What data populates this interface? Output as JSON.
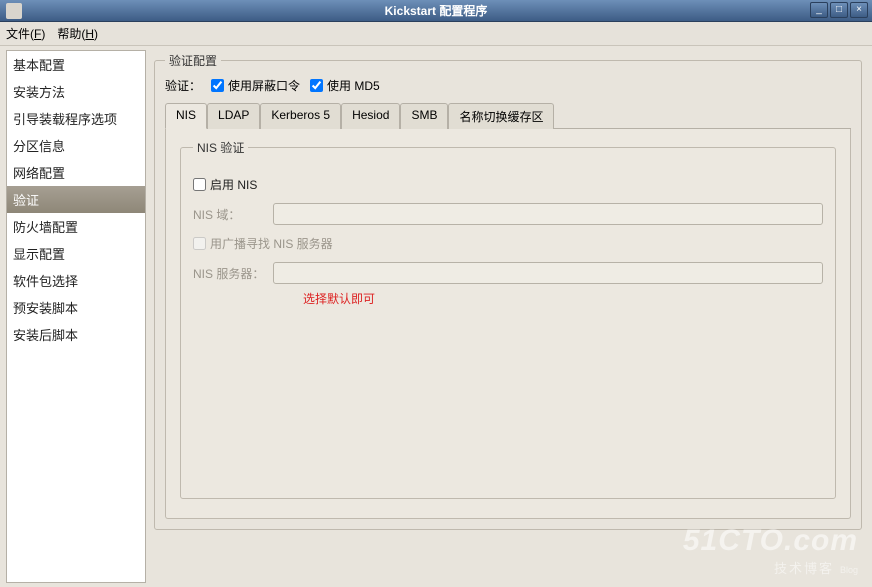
{
  "window": {
    "title": "Kickstart 配置程序",
    "min": "_",
    "max": "□",
    "close": "×"
  },
  "menu": {
    "file": "文件",
    "file_mn": "F",
    "help": "帮助",
    "help_mn": "H"
  },
  "sidebar": {
    "items": [
      "基本配置",
      "安装方法",
      "引导装载程序选项",
      "分区信息",
      "网络配置",
      "验证",
      "防火墙配置",
      "显示配置",
      "软件包选择",
      "预安装脚本",
      "安装后脚本"
    ],
    "selected_index": 5
  },
  "auth": {
    "group_title": "验证配置",
    "label": "验证：",
    "shadow_label": "使用屏蔽口令",
    "shadow_checked": true,
    "md5_label": "使用 MD5",
    "md5_checked": true
  },
  "tabs": {
    "items": [
      "NIS",
      "LDAP",
      "Kerberos 5",
      "Hesiod",
      "SMB",
      "名称切换缓存区"
    ],
    "active_index": 0
  },
  "nis": {
    "group_title": "NIS 验证",
    "enable_label": "启用 NIS",
    "enable_checked": false,
    "domain_label": "NIS 域：",
    "domain_value": "",
    "broadcast_label": "用广播寻找 NIS 服务器",
    "broadcast_checked": false,
    "server_label": "NIS 服务器：",
    "server_value": ""
  },
  "annotation": "选择默认即可",
  "watermark": {
    "line1": "51CTO.com",
    "line2": "技术博客",
    "blog": "Blog"
  }
}
